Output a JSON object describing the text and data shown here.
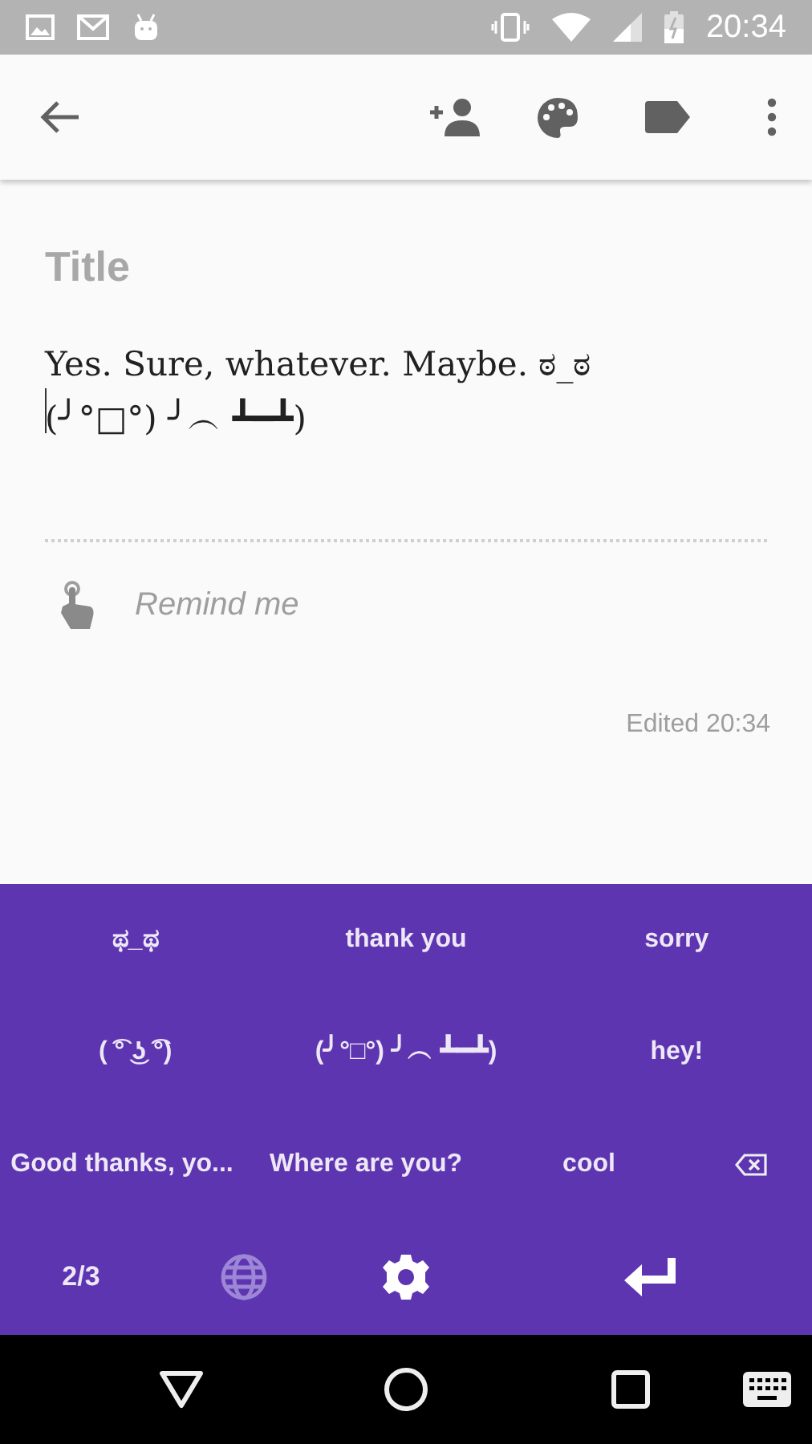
{
  "status_bar": {
    "time": "20:34"
  },
  "note": {
    "title_placeholder": "Title",
    "body": "Yes. Sure, whatever. Maybe. ಠ_ಠ\n(╯°□°) ╯︵ ┻━┻)",
    "reminder_placeholder": "Remind me",
    "edited": "Edited 20:34"
  },
  "keyboard": {
    "rows": [
      [
        {
          "kind": "text",
          "label": "ಥ_ಥ"
        },
        {
          "kind": "text",
          "label": "thank you"
        },
        {
          "kind": "text",
          "label": "sorry"
        }
      ],
      [
        {
          "kind": "text",
          "label": "( ͡° ͜ʖ ͡°)"
        },
        {
          "kind": "text",
          "label": "(╯°□°) ╯︵ ┻━┻)"
        },
        {
          "kind": "text",
          "label": "hey!"
        }
      ],
      [
        {
          "kind": "text",
          "label": "Good thanks, yo..."
        },
        {
          "kind": "text",
          "label": "Where are you?"
        },
        {
          "kind": "text",
          "label": "cool"
        },
        {
          "kind": "backspace"
        }
      ],
      [
        {
          "kind": "page",
          "label": "2/3"
        },
        {
          "kind": "globe",
          "disabled": true
        },
        {
          "kind": "settings",
          "disabled": false
        },
        {
          "kind": "enter",
          "disabled": false
        }
      ]
    ]
  }
}
